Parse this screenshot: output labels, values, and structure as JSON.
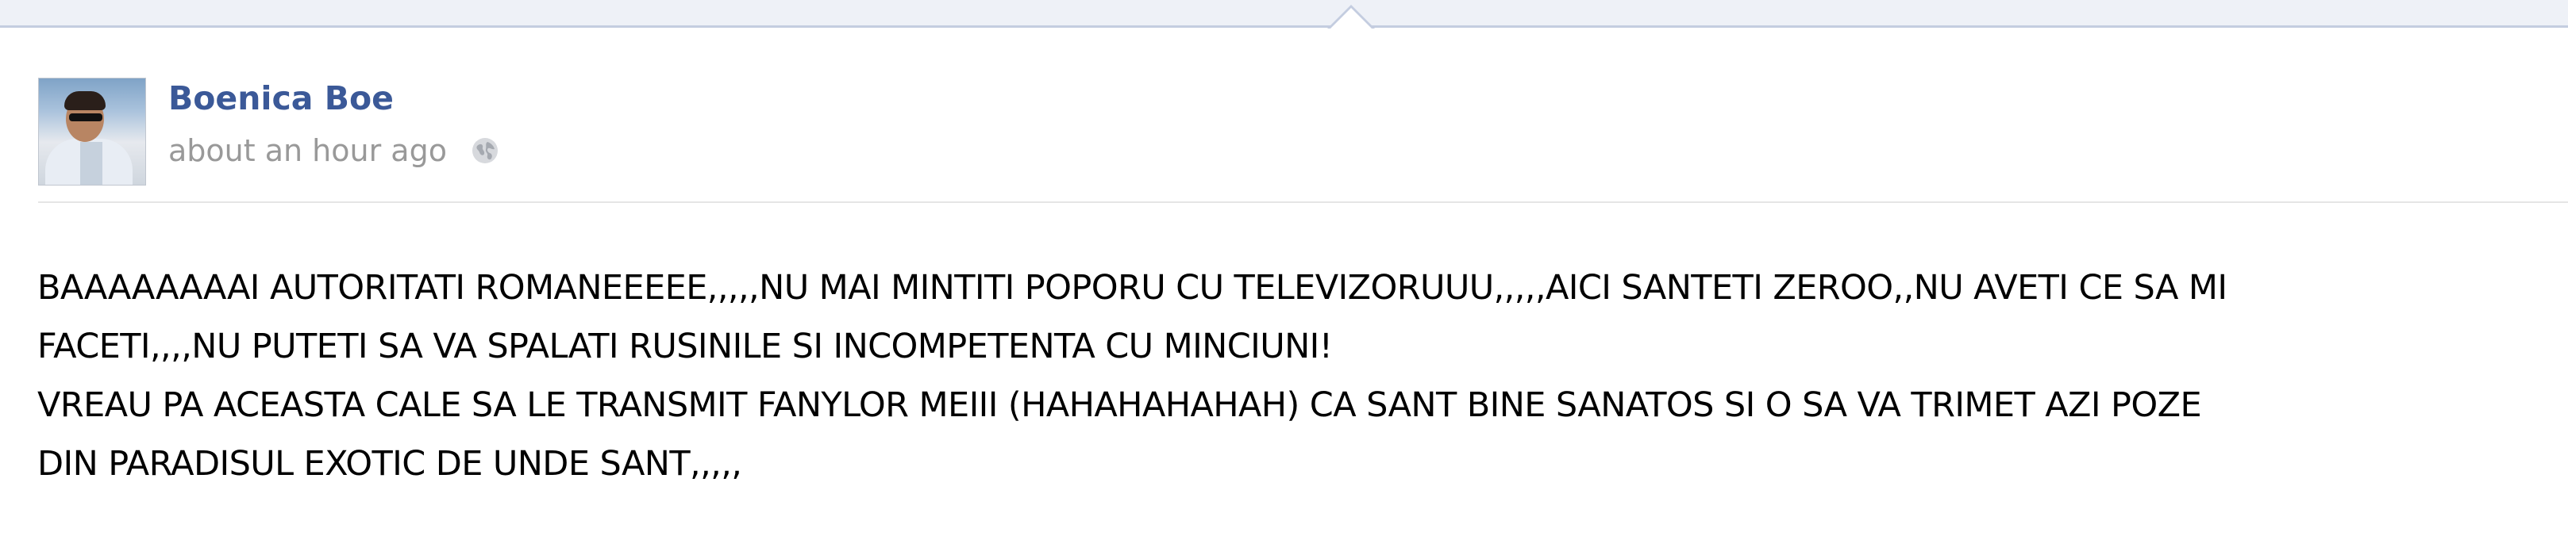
{
  "post": {
    "author_name": "Boenica Boe",
    "timestamp": "about an hour ago",
    "privacy_icon": "globe-icon",
    "message_lines": [
      "BAAAAAAAAI AUTORITATI ROMANEEEEE,,,,,NU MAI MINTITI POPORU CU TELEVIZORUUU,,,,,AICI SANTETI ZEROO,,NU AVETI CE SA MI",
      "FACETI,,,,NU PUTETI SA VA SPALATI RUSINILE SI INCOMPETENTA CU MINCIUNI!",
      "VREAU PA ACEASTA CALE SA LE TRANSMIT FANYLOR MEIII (HAHAHAHAHAH) CA SANT BINE SANATOS SI O SA VA TRIMET AZI POZE",
      "DIN PARADISUL EXOTIC DE UNDE SANT,,,,,"
    ]
  },
  "colors": {
    "author_link": "#3b5998",
    "timestamp": "#999999",
    "message_text": "#000000",
    "top_band": "#eef1f7",
    "top_band_border": "#c4cde0"
  }
}
